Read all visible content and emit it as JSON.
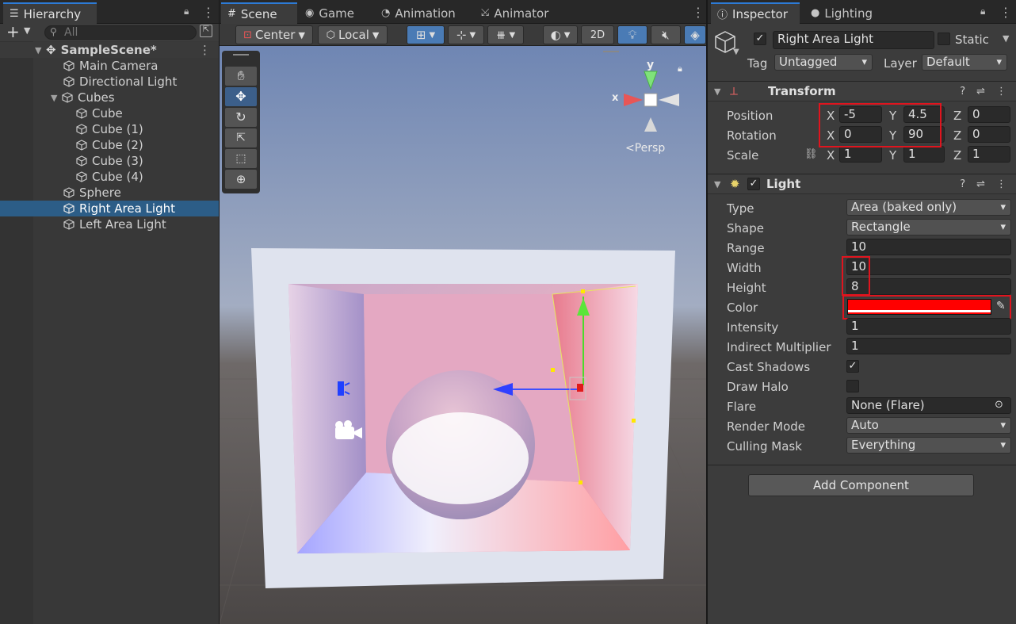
{
  "hierarchy": {
    "tab_label": "Hierarchy",
    "search_placeholder": "All",
    "scene_name": "SampleScene*",
    "items": [
      {
        "label": "Main Camera"
      },
      {
        "label": "Directional Light"
      },
      {
        "label": "Cubes"
      },
      {
        "label": "Cube"
      },
      {
        "label": "Cube (1)"
      },
      {
        "label": "Cube (2)"
      },
      {
        "label": "Cube (3)"
      },
      {
        "label": "Cube (4)"
      },
      {
        "label": "Sphere"
      },
      {
        "label": "Right Area Light"
      },
      {
        "label": "Left Area Light"
      }
    ]
  },
  "scene": {
    "tabs": [
      "Scene",
      "Game",
      "Animation",
      "Animator"
    ],
    "toolbar": {
      "pivot": "Center",
      "space": "Local",
      "mode_2d": "2D"
    },
    "gizmo": {
      "y_label": "y",
      "x_label": "x",
      "projection": "Persp"
    }
  },
  "inspector": {
    "tabs": [
      "Inspector",
      "Lighting"
    ],
    "object_name": "Right Area Light",
    "static_label": "Static",
    "tag_label": "Tag",
    "tag_value": "Untagged",
    "layer_label": "Layer",
    "layer_value": "Default",
    "transform": {
      "title": "Transform",
      "position_label": "Position",
      "rotation_label": "Rotation",
      "scale_label": "Scale",
      "position": {
        "x": "-5",
        "y": "4.5",
        "z": "0"
      },
      "rotation": {
        "x": "0",
        "y": "90",
        "z": "0"
      },
      "scale": {
        "x": "1",
        "y": "1",
        "z": "1"
      },
      "axis_x": "X",
      "axis_y": "Y",
      "axis_z": "Z"
    },
    "light": {
      "title": "Light",
      "type_label": "Type",
      "type_value": "Area (baked only)",
      "shape_label": "Shape",
      "shape_value": "Rectangle",
      "range_label": "Range",
      "range_value": "10",
      "width_label": "Width",
      "width_value": "10",
      "height_label": "Height",
      "height_value": "8",
      "color_label": "Color",
      "color_value": "#ff0000",
      "intensity_label": "Intensity",
      "intensity_value": "1",
      "indirect_label": "Indirect Multiplier",
      "indirect_value": "1",
      "shadows_label": "Cast Shadows",
      "halo_label": "Draw Halo",
      "flare_label": "Flare",
      "flare_value": "None (Flare)",
      "render_label": "Render Mode",
      "render_value": "Auto",
      "culling_label": "Culling Mask",
      "culling_value": "Everything"
    },
    "add_component": "Add Component"
  }
}
